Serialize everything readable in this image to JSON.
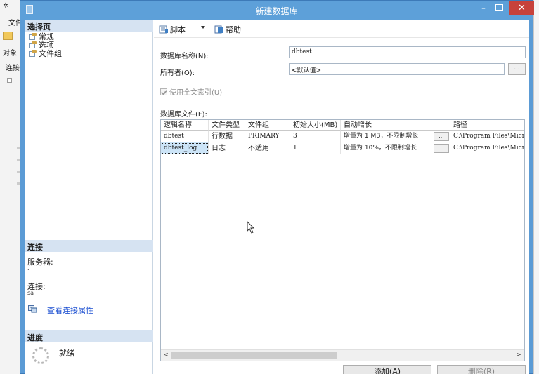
{
  "background_app": {
    "menu_item": "文件",
    "panel_label": "对象",
    "connect_label": "连接"
  },
  "window": {
    "title": "新建数据库",
    "minimize": "–",
    "close": "✕"
  },
  "left_pane": {
    "select_page_header": "选择页",
    "pages": [
      {
        "label": "常规"
      },
      {
        "label": "选项"
      },
      {
        "label": "文件组"
      }
    ],
    "connection_header": "连接",
    "server_label": "服务器:",
    "server_value": ".",
    "connection_label": "连接:",
    "connection_value": "sa",
    "view_connection_link": "查看连接属性",
    "progress_header": "进度",
    "progress_status": "就绪"
  },
  "toolbar": {
    "script_label": "脚本",
    "help_label": "帮助"
  },
  "form": {
    "db_name_label": "数据库名称(N):",
    "db_name_value": "dbtest",
    "owner_label": "所有者(O):",
    "owner_value": "<默认值>",
    "browse_label": "...",
    "fulltext_label": "使用全文索引(U)",
    "fulltext_checked": true,
    "db_files_label": "数据库文件(F):"
  },
  "files_grid": {
    "columns": [
      "逻辑名称",
      "文件类型",
      "文件组",
      "初始大小(MB)",
      "自动增长",
      "路径"
    ],
    "rows": [
      {
        "logical_name": "dbtest",
        "file_type": "行数据",
        "filegroup": "PRIMARY",
        "initial_size": "3",
        "autogrowth": "增量为 1 MB，不限制增长",
        "path": "C:\\Program Files\\Microsoft"
      },
      {
        "logical_name": "dbtest_log",
        "file_type": "日志",
        "filegroup": "不适用",
        "initial_size": "1",
        "autogrowth": "增量为 10%，不限制增长",
        "path": "C:\\Program Files\\Microsoft"
      }
    ],
    "cell_button": "...",
    "scroll_left": "<",
    "scroll_right": ">"
  },
  "buttons": {
    "add_label": "添加(A)",
    "remove_label": "删除(R)"
  }
}
